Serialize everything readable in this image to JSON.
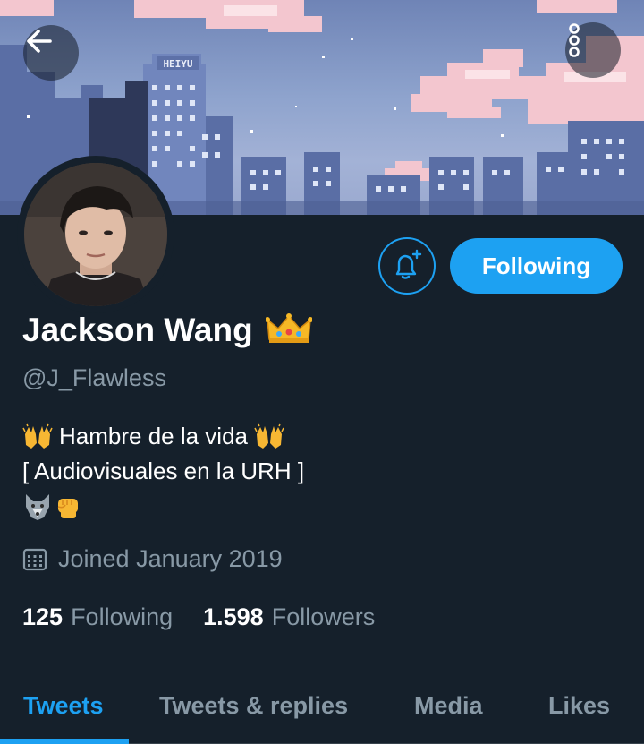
{
  "banner": {
    "sign_text": "HEIYU",
    "back_icon": "arrow-left-icon",
    "more_icon": "overflow-menu-icon"
  },
  "profile": {
    "name": "Jackson Wang",
    "name_emoji": "crown-icon",
    "handle": "@J_Flawless",
    "bio_line1": "Hambre de la vida",
    "bio_line1_emoji": "raising-hands-icon",
    "bio_line2": "[ Audiovisuales en la URH ]",
    "bio_line3_emojis": [
      "wolf-icon",
      "fist-icon"
    ],
    "joined": "Joined January 2019",
    "joined_icon": "calendar-icon"
  },
  "actions": {
    "notify_icon": "bell-plus-icon",
    "follow_label": "Following"
  },
  "stats": {
    "following_count": "125",
    "following_label": "Following",
    "followers_count": "1.598",
    "followers_label": "Followers"
  },
  "tabs": [
    {
      "label": "Tweets",
      "active": true
    },
    {
      "label": "Tweets & replies",
      "active": false
    },
    {
      "label": "Media",
      "active": false
    },
    {
      "label": "Likes",
      "active": false
    }
  ],
  "colors": {
    "background": "#15202b",
    "accent": "#1da1f2",
    "secondary_text": "#8899a6"
  }
}
